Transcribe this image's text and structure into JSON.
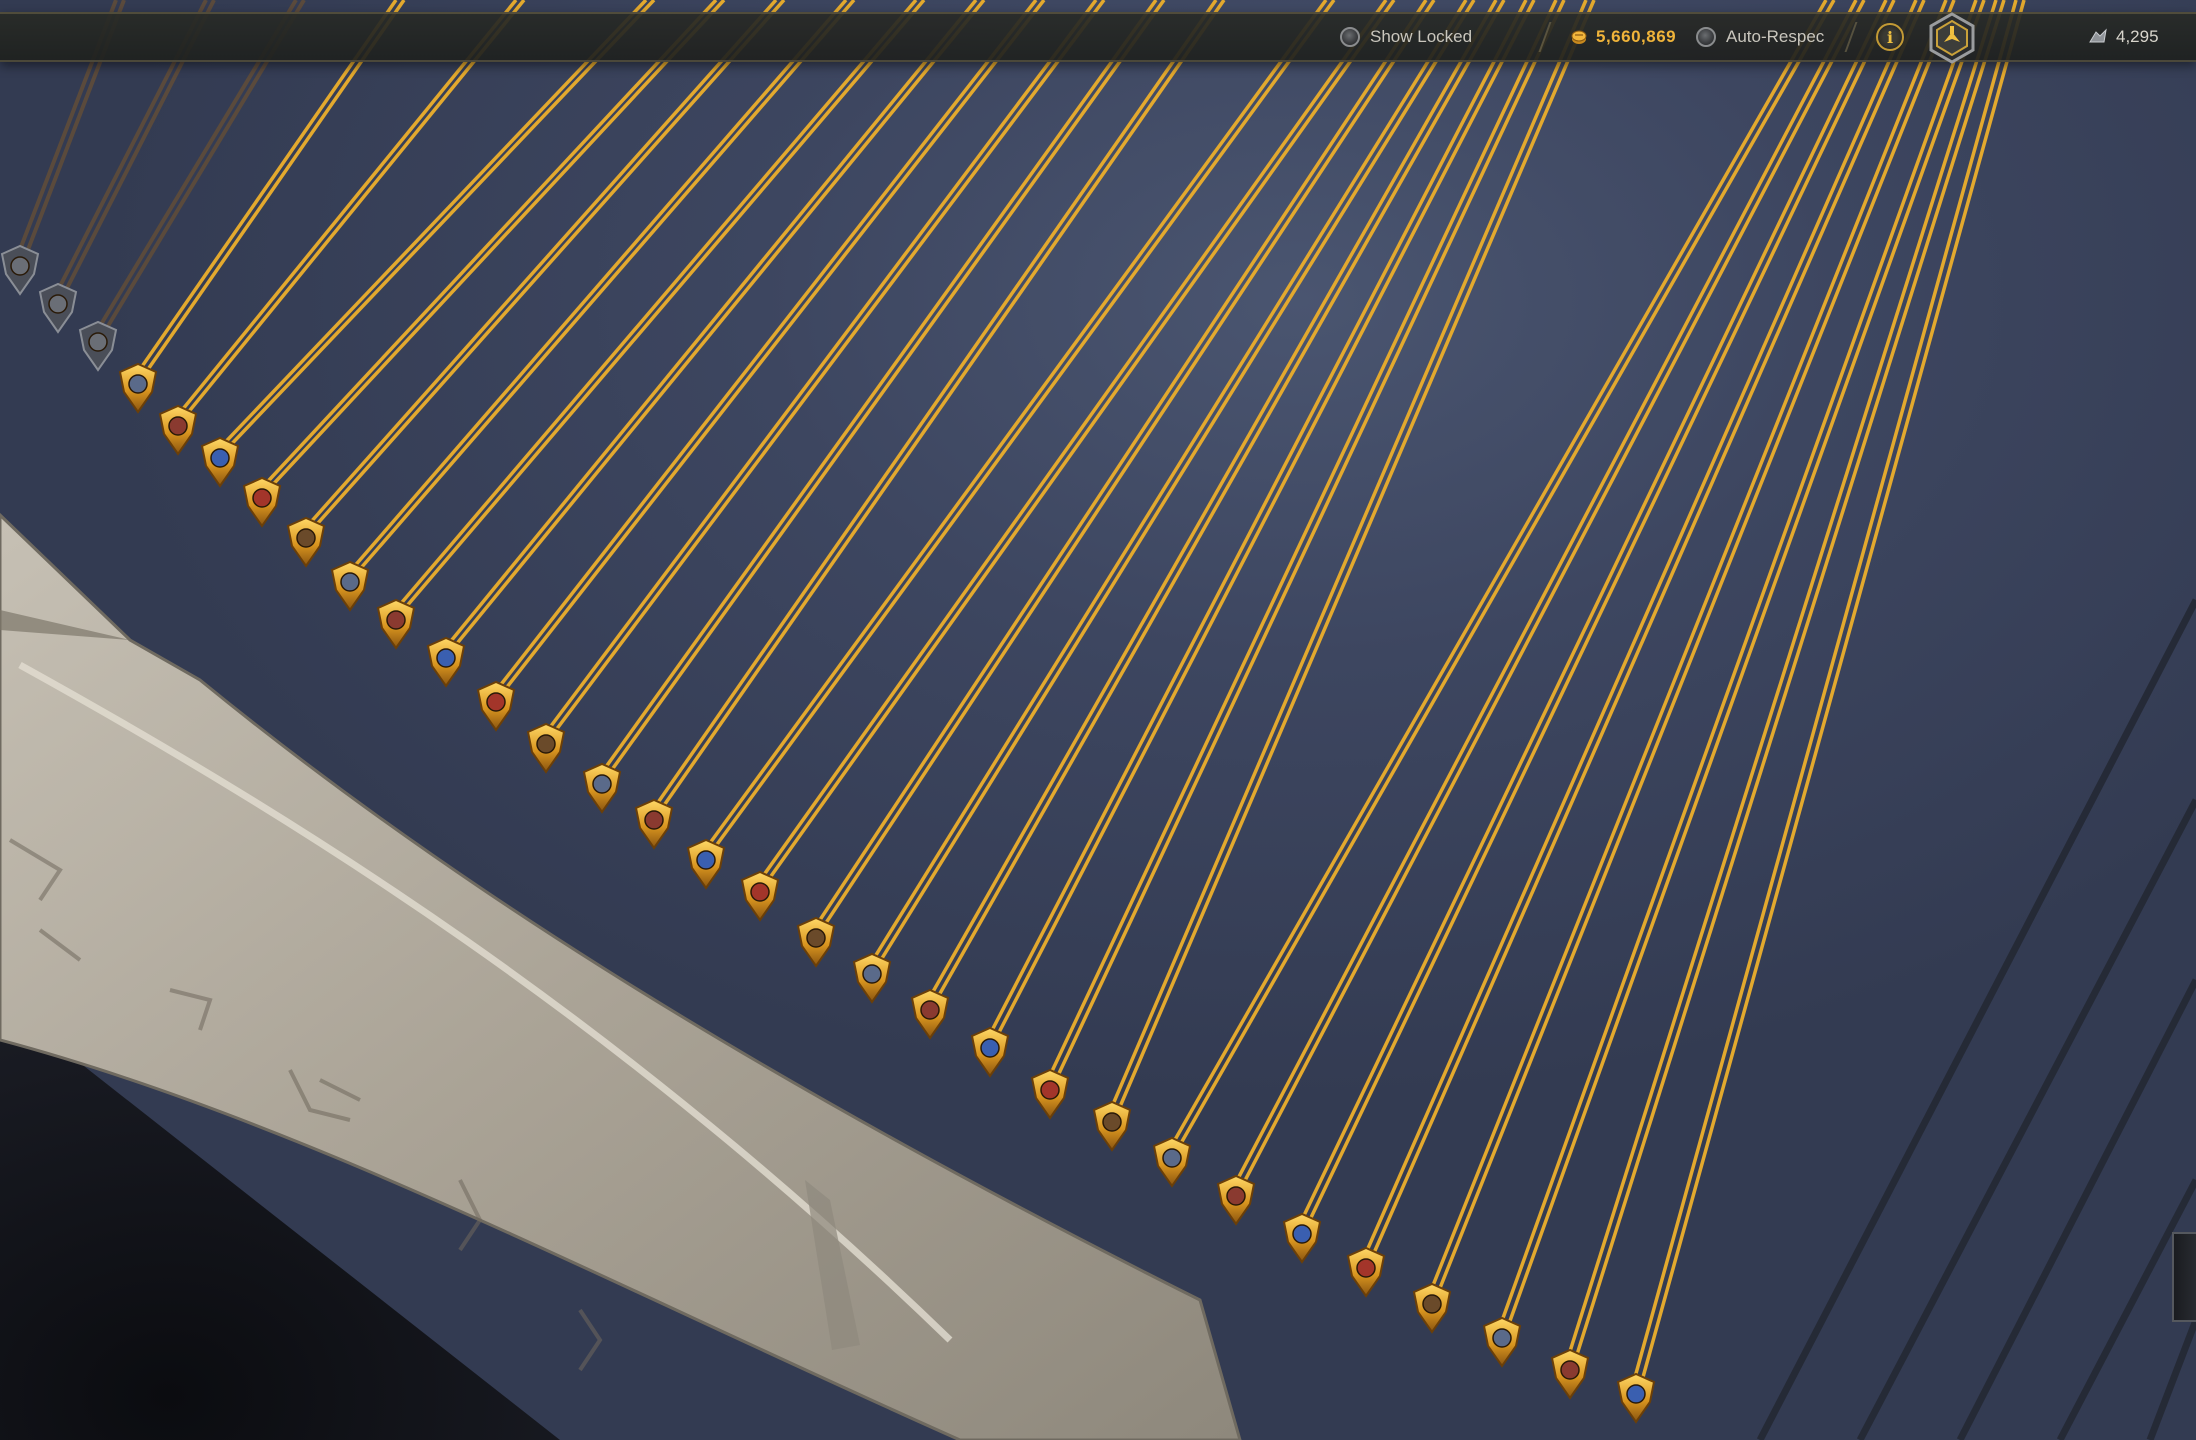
{
  "toolbar": {
    "show_locked_label": "Show Locked",
    "show_locked_checked": false,
    "currency_value": "5,660,869",
    "auto_respec_label": "Auto-Respec",
    "auto_respec_checked": false,
    "info_icon": "info-icon",
    "hex_icon": "champion-hex-icon",
    "resource_value": "4,295",
    "resource_icon": "glyph-resource-icon"
  },
  "colors": {
    "background": "#3d4660",
    "gold_line": "#e3a92e",
    "gold_text": "#f0b43a",
    "locked_line": "#5a4a3c",
    "stone": "#b7b0a3",
    "toolbar_bg": "#2a2b27"
  },
  "icons": {
    "node": "champion-node-icon",
    "locked_node": "locked-node-icon"
  }
}
